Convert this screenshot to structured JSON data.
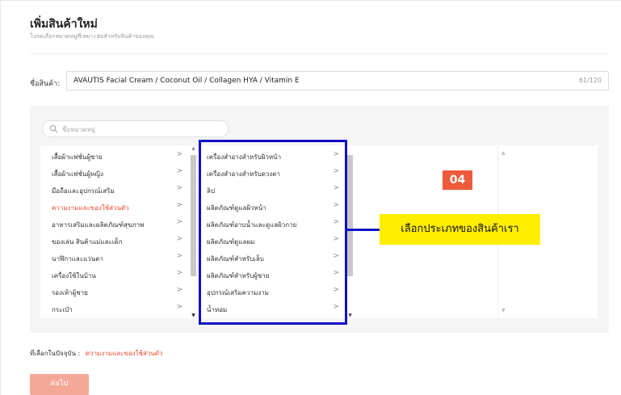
{
  "header": {
    "title": "เพิ่มสินค้าใหม่",
    "subtitle": "โปรดเลือกหมวดหมู่ที่เหมาะสมสำหรับสินค้าของคุณ"
  },
  "product_name": {
    "label": "ชื่อสินค้า:",
    "value": "AVAUTIS Facial Cream / Coconut Oil / Collagen HYA / Vitamin E",
    "count": "61/120"
  },
  "category_search": {
    "placeholder": "ชื่อหมวดหมู่"
  },
  "category_level1": [
    {
      "label": "เสื้อผ้าแฟชั่นผู้ชาย",
      "active": false
    },
    {
      "label": "เสื้อผ้าแฟชั่นผู้หญิง",
      "active": false
    },
    {
      "label": "มือถือและอุปกรณ์เสริม",
      "active": false
    },
    {
      "label": "ความงามและของใช้ส่วนตัว",
      "active": true
    },
    {
      "label": "อาหารเสริมและผลิตภัณฑ์สุขภาพ",
      "active": false
    },
    {
      "label": "ของเล่น สินค้าแม่และเด็ก",
      "active": false
    },
    {
      "label": "นาฬิกาและแว่นตา",
      "active": false
    },
    {
      "label": "เครื่องใช้ในบ้าน",
      "active": false
    },
    {
      "label": "รองเท้าผู้ชาย",
      "active": false
    },
    {
      "label": "กระเป๋า",
      "active": false
    }
  ],
  "category_level2": [
    {
      "label": "เครื่องสำอางสำหรับผิวหน้า"
    },
    {
      "label": "เครื่องสำอางสำหรับดวงตา"
    },
    {
      "label": "ลิป"
    },
    {
      "label": "ผลิตภัณฑ์ดูแลผิวหน้า"
    },
    {
      "label": "ผลิตภัณฑ์อาบน้ำและดูแลผิวกาย"
    },
    {
      "label": "ผลิตภัณฑ์ดูแลผม"
    },
    {
      "label": "ผลิตภัณฑ์สำหรับเล็บ"
    },
    {
      "label": "ผลิตภัณฑ์สำหรับผู้ชาย"
    },
    {
      "label": "อุปกรณ์เสริมความงาม"
    },
    {
      "label": "น้ำหอม"
    }
  ],
  "chevron": ">",
  "annotation": {
    "step": "04",
    "callout": "เลือกประเภทของสินค้าเรา",
    "box_color": "#1010c8",
    "badge_color": "#ee5a3c",
    "callout_color": "#ffee00"
  },
  "selection": {
    "label": "ที่เลือกในปัจจุบัน :",
    "value": "ความงามและของใช้ส่วนตัว"
  },
  "next_button": {
    "label": "ต่อไป"
  },
  "colors": {
    "accent": "#ee4d2d",
    "button_disabled": "#f5a898"
  }
}
